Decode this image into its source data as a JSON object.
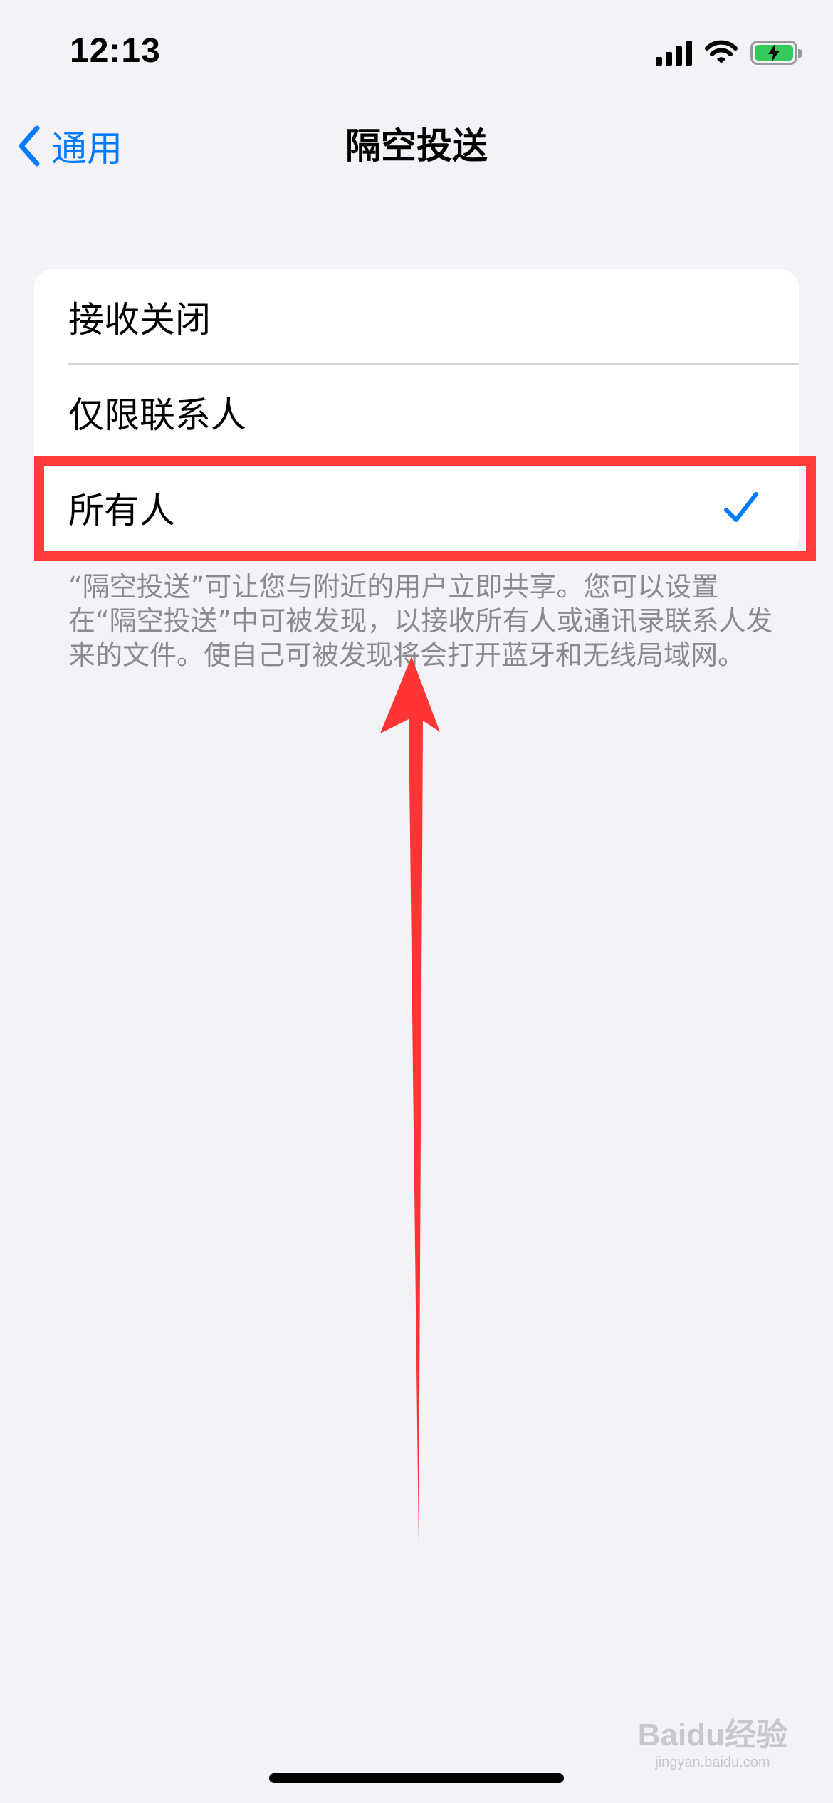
{
  "status_bar": {
    "time": "12:13"
  },
  "nav": {
    "back_label": "通用",
    "title": "隔空投送"
  },
  "options": [
    {
      "label": "接收关闭",
      "selected": false
    },
    {
      "label": "仅限联系人",
      "selected": false
    },
    {
      "label": "所有人",
      "selected": true
    }
  ],
  "footer": {
    "text": "“隔空投送”可让您与附近的用户立即共享。您可以设置在“隔空投送”中可被发现，以接收所有人或通讯录联系人发来的文件。使自己可被发现将会打开蓝牙和无线局域网。"
  },
  "watermark": {
    "brand": "Baidu经验",
    "url": "jingyan.baidu.com"
  },
  "colors": {
    "accent": "#007aff",
    "background": "#f2f2f7",
    "annotation": "#ff3b3b",
    "battery": "#34c759"
  },
  "icons": {
    "back": "chevron-left-icon",
    "check": "checkmark-icon",
    "signal": "cellular-signal-icon",
    "wifi": "wifi-icon",
    "battery": "battery-charging-icon"
  }
}
